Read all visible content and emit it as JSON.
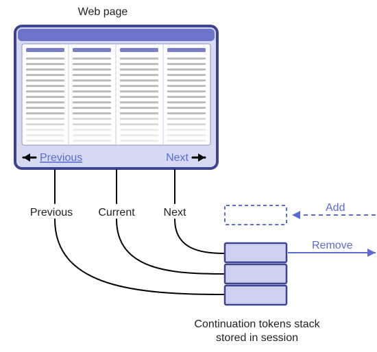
{
  "title": "Web page",
  "page": {
    "prev_label": "Previous",
    "next_label": "Next"
  },
  "connectors": {
    "prev": "Previous",
    "current": "Current",
    "next": "Next"
  },
  "stack": {
    "add_label": "Add",
    "remove_label": "Remove",
    "caption_line1": "Continuation tokens stack",
    "caption_line2": "stored in session"
  }
}
